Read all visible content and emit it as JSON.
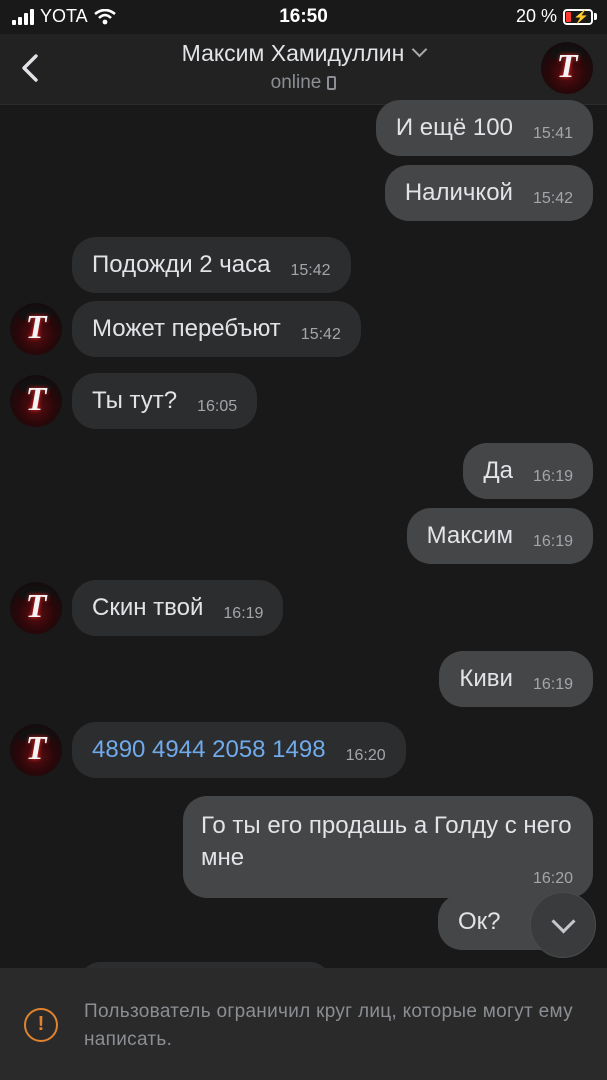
{
  "status_bar": {
    "carrier": "YOTA",
    "time": "16:50",
    "battery": "20 %"
  },
  "header": {
    "name": "Максим Хамидуллин",
    "status": "online"
  },
  "messages": [
    {
      "dir": "out",
      "text": "И ещё 100",
      "time": "15:41"
    },
    {
      "dir": "out",
      "text": "Наличкой",
      "time": "15:42"
    },
    {
      "dir": "in",
      "text": "Подожди 2 часа",
      "time": "15:42"
    },
    {
      "dir": "in",
      "text": "Может перебъют",
      "time": "15:42"
    },
    {
      "dir": "in",
      "text": "Ты тут?",
      "time": "16:05"
    },
    {
      "dir": "out",
      "text": "Да",
      "time": "16:19"
    },
    {
      "dir": "out",
      "text": "Максим",
      "time": "16:19"
    },
    {
      "dir": "in",
      "text": "Скин твой",
      "time": "16:19"
    },
    {
      "dir": "out",
      "text": "Киви",
      "time": "16:19"
    },
    {
      "dir": "in",
      "text": "4890 4944 2058 1498",
      "time": "16:20"
    },
    {
      "dir": "out",
      "text": "Го ты его продашь а Голду с него мне",
      "time": "16:20"
    },
    {
      "dir": "out",
      "text": "Ок?",
      "time": ""
    }
  ],
  "notice": {
    "text": "Пользователь ограничил круг лиц, которые могут ему написать."
  }
}
